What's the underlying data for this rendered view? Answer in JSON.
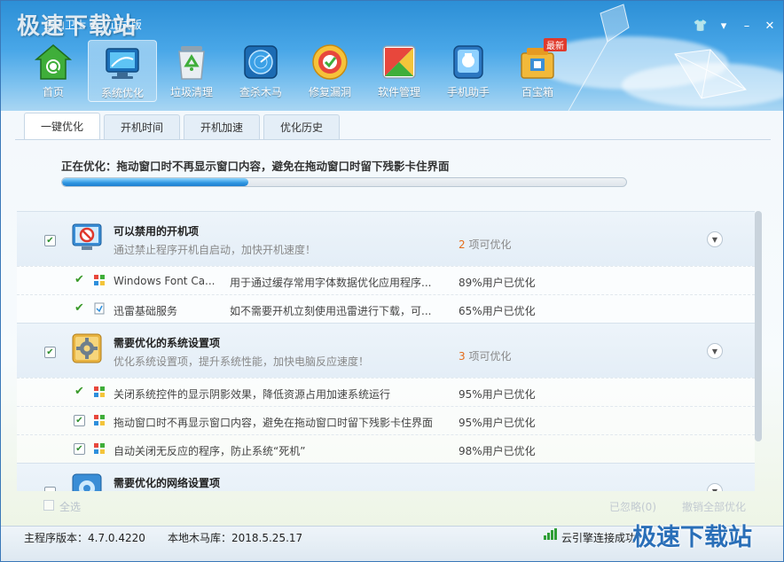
{
  "app": {
    "watermark": "极速下载站",
    "title": "金山卫士 4.7 正式版"
  },
  "window_buttons": {
    "skin": "👕",
    "menu": "▾",
    "minimize": "–",
    "close": "✕"
  },
  "nav": {
    "items": [
      {
        "label": "首页",
        "icon": "home-shield-icon"
      },
      {
        "label": "系统优化",
        "icon": "monitor-icon"
      },
      {
        "label": "垃圾清理",
        "icon": "recycle-bin-icon"
      },
      {
        "label": "查杀木马",
        "icon": "radar-icon"
      },
      {
        "label": "修复漏洞",
        "icon": "patch-icon"
      },
      {
        "label": "软件管理",
        "icon": "software-icon"
      },
      {
        "label": "手机助手",
        "icon": "phone-icon"
      },
      {
        "label": "百宝箱",
        "icon": "toolbox-icon",
        "badge": "最新"
      }
    ],
    "active_index": 1
  },
  "tabs": [
    "一键优化",
    "开机时间",
    "开机加速",
    "优化历史"
  ],
  "progress": {
    "label": "正在优化：拖动窗口时不再显示窗口内容，避免在拖动窗口时留下残影卡住界面",
    "value": 0.33
  },
  "groups": [
    {
      "title": "可以禁用的开机项",
      "desc": "通过禁止程序开机自启动，加快开机速度！",
      "count_num": "2",
      "count_suffix": " 项可优化",
      "icon": "forbidden-monitor-icon",
      "rows": [
        {
          "name": "Windows Font Ca...",
          "desc": "用于通过缓存常用字体数据优化应用程序...",
          "pct": "89%用户已优化",
          "icon": "windows-flag-icon",
          "state": "done"
        },
        {
          "name": "迅雷基础服务",
          "desc": "如不需要开机立刻使用迅雷进行下载，可...",
          "pct": "65%用户已优化",
          "icon": "service-doc-icon",
          "state": "done"
        }
      ]
    },
    {
      "title": "需要优化的系统设置项",
      "desc": "优化系统设置项，提升系统性能，加快电脑反应速度！",
      "count_num": "3",
      "count_suffix": " 项可优化",
      "icon": "gear-settings-icon",
      "rows": [
        {
          "desc": "关闭系统控件的显示阴影效果，降低资源占用加速系统运行",
          "pct": "95%用户已优化",
          "icon": "windows-flag-icon",
          "state": "done"
        },
        {
          "desc": "拖动窗口时不再显示窗口内容，避免在拖动窗口时留下残影卡住界面",
          "pct": "95%用户已优化",
          "icon": "windows-flag-icon",
          "state": "checked"
        },
        {
          "desc": "自动关闭无反应的程序，防止系统“死机”",
          "pct": "98%用户已优化",
          "icon": "windows-flag-icon",
          "state": "checked"
        }
      ]
    },
    {
      "title": "需要优化的网络设置项",
      "icon": "network-settings-icon"
    }
  ],
  "footer": {
    "select_all": "全选",
    "ignored": "已忽略(0)",
    "undo_all": "撤销全部优化"
  },
  "status": {
    "version": "主程序版本：4.7.0.4220",
    "trojan_db": "本地木马库：2018.5.25.17",
    "cloud": "云引擎连接成功",
    "watermark": "极速下载站"
  },
  "colors": {
    "accent": "#2d95e0",
    "count_highlight": "#e46c1c",
    "done_tick": "#3a9a2a"
  }
}
